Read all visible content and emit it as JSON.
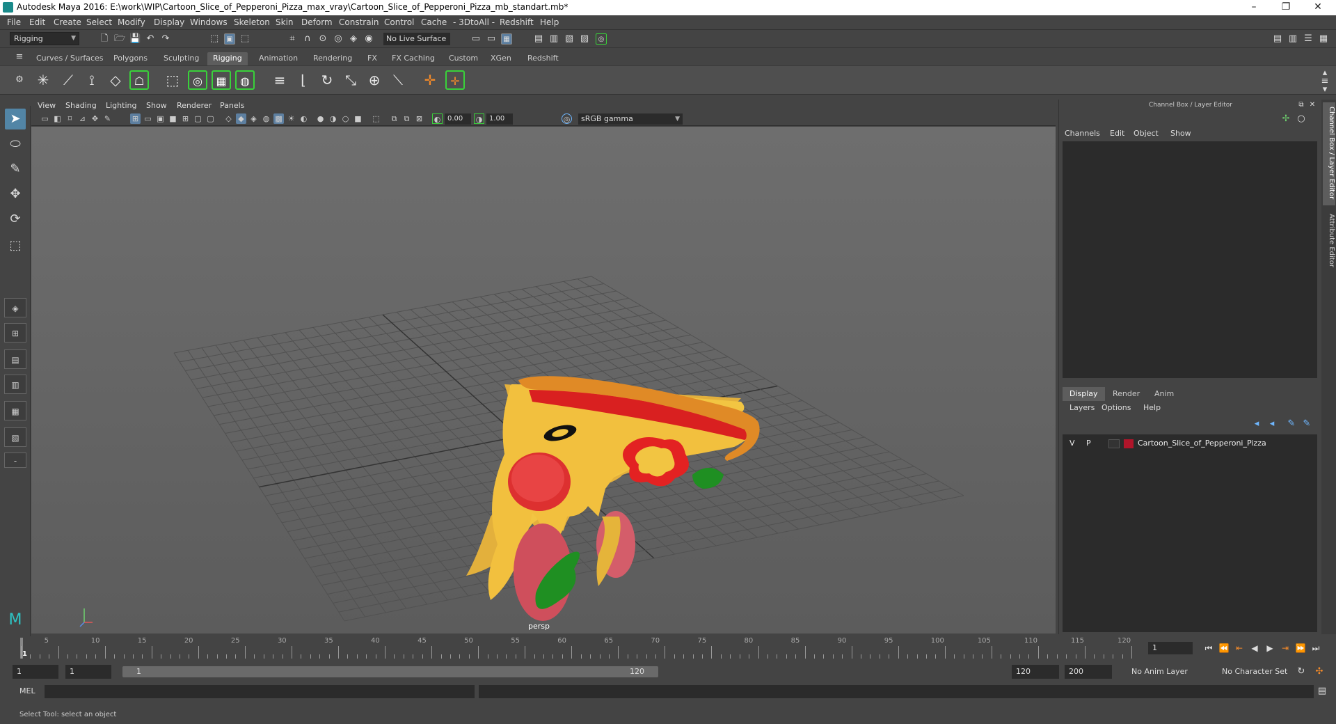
{
  "title": "Autodesk Maya 2016: E:\\work\\WIP\\Cartoon_Slice_of_Pepperoni_Pizza_max_vray\\Cartoon_Slice_of_Pepperoni_Pizza_mb_standart.mb*",
  "menu": [
    "File",
    "Edit",
    "Create",
    "Select",
    "Modify",
    "Display",
    "Windows",
    "Skeleton",
    "Skin",
    "Deform",
    "Constrain",
    "Control",
    "Cache",
    "- 3DtoAll -",
    "Redshift",
    "Help"
  ],
  "status": {
    "mode": "Rigging",
    "live_surface": "No Live Surface"
  },
  "shelf_tabs": [
    "Curves / Surfaces",
    "Polygons",
    "Sculpting",
    "Rigging",
    "Animation",
    "Rendering",
    "FX",
    "FX Caching",
    "Custom",
    "XGen",
    "Redshift"
  ],
  "shelf_active": "Rigging",
  "panel_menu": [
    "View",
    "Shading",
    "Lighting",
    "Show",
    "Renderer",
    "Panels"
  ],
  "panel_toolbar": {
    "exposure": "0.00",
    "gamma": "1.00",
    "colorspace": "sRGB gamma"
  },
  "viewport": {
    "camera": "persp"
  },
  "channel_box": {
    "title": "Channel Box / Layer Editor",
    "menu": [
      "Channels",
      "Edit",
      "Object",
      "Show"
    ]
  },
  "layer_editor": {
    "tabs": [
      "Display",
      "Render",
      "Anim"
    ],
    "active_tab": "Display",
    "menu": [
      "Layers",
      "Options",
      "Help"
    ],
    "layers": [
      {
        "v": "V",
        "p": "P",
        "name": "Cartoon_Slice_of_Pepperoni_Pizza",
        "color": "#b0152a"
      }
    ]
  },
  "side_tabs": [
    "Channel Box / Layer Editor",
    "Attribute Editor"
  ],
  "timeline": {
    "ticks": [
      "1",
      "5",
      "10",
      "15",
      "20",
      "25",
      "30",
      "35",
      "40",
      "45",
      "50",
      "55",
      "60",
      "65",
      "70",
      "75",
      "80",
      "85",
      "90",
      "95",
      "100",
      "105",
      "110",
      "115",
      "120"
    ],
    "current_frame": "1"
  },
  "range": {
    "start": "1",
    "playback_start": "1",
    "slider_start": "1",
    "slider_end": "120",
    "playback_end": "120",
    "end": "200",
    "anim_layer": "No Anim Layer",
    "character_set": "No Character Set"
  },
  "cmd": {
    "label": "MEL"
  },
  "help": "Select Tool: select an object"
}
